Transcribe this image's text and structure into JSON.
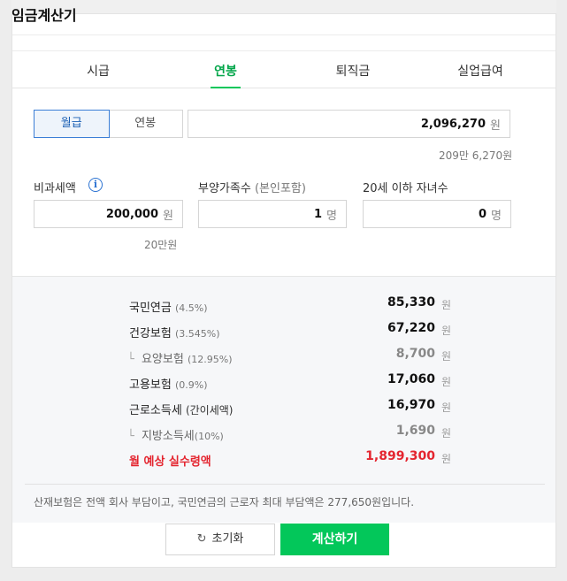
{
  "page_title": "임금계산기",
  "tabs": [
    {
      "label": "시급",
      "active": false
    },
    {
      "label": "연봉",
      "active": true
    },
    {
      "label": "퇴직금",
      "active": false
    },
    {
      "label": "실업급여",
      "active": false
    }
  ],
  "pay_type": {
    "options": [
      "월급",
      "연봉"
    ],
    "selected": "월급"
  },
  "salary": {
    "value": "2,096,270",
    "unit": "원",
    "korean": "209만 6,270원"
  },
  "nontax": {
    "label": "비과세액",
    "value": "200,000",
    "unit": "원",
    "korean": "20만원"
  },
  "dependents": {
    "label": "부양가족수",
    "label_sub": "(본인포함)",
    "value": "1",
    "unit": "명"
  },
  "children": {
    "label": "20세 이하 자녀수",
    "value": "0",
    "unit": "명"
  },
  "results": [
    {
      "name": "국민연금",
      "detail": "(4.5%)",
      "value": "85,330",
      "unit": "원"
    },
    {
      "name": "건강보험",
      "detail": "(3.545%)",
      "value": "67,220",
      "unit": "원"
    },
    {
      "name": "요양보험",
      "detail": "(12.95%)",
      "value": "8,700",
      "unit": "원"
    },
    {
      "name": "고용보험",
      "detail": "(0.9%)",
      "value": "17,060",
      "unit": "원"
    },
    {
      "name": "근로소득세",
      "detail": "(간이세액)",
      "value": "16,970",
      "unit": "원"
    },
    {
      "name": "지방소득세",
      "detail": "(10%)",
      "value": "1,690",
      "unit": "원"
    },
    {
      "name": "월 예상 실수령액",
      "detail": "",
      "value": "1,899,300",
      "unit": "원"
    }
  ],
  "note": "산재보험은 전액 회사 부담이고, 국민연금의 근로자 최대 부담액은 277,650원입니다.",
  "buttons": {
    "reset": "초기화",
    "calculate": "계산하기"
  },
  "colors": {
    "accent": "#03c75a",
    "highlight": "#e4252f",
    "select_blue": "#1a5fb4"
  },
  "icons": {
    "info": "info-icon",
    "reset": "refresh-icon",
    "sub_item": "corner-arrow-icon"
  }
}
